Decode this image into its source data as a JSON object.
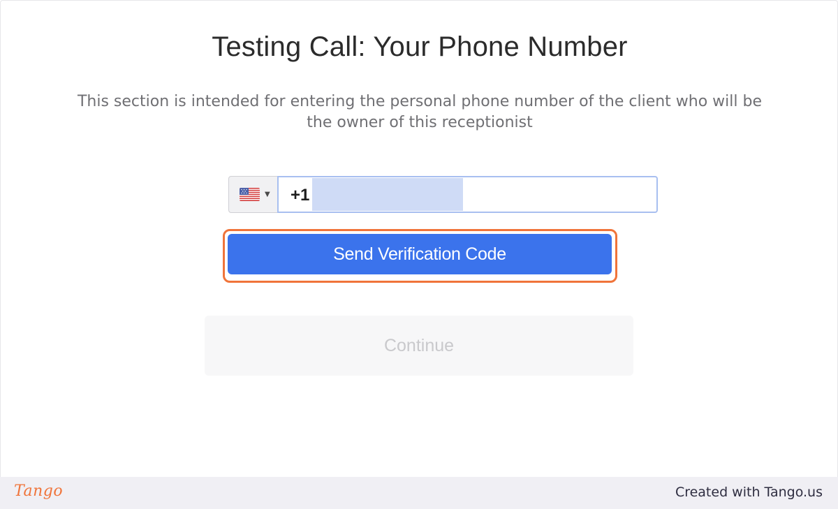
{
  "page": {
    "title": "Testing Call: Your Phone Number",
    "description": "This section is intended for entering the personal phone number of the client who will be the owner of this receptionist"
  },
  "phone_field": {
    "country_flag_icon": "us-flag-icon",
    "dial_code": "+1",
    "value_redacted": true
  },
  "buttons": {
    "send_verification": "Send Verification Code",
    "continue": "Continue"
  },
  "footer": {
    "logo_text": "Tango",
    "credit": "Created with Tango.us"
  },
  "colors": {
    "primary": "#3b73ec",
    "highlight": "#f0743a",
    "footer_bg": "#f0eff4"
  }
}
